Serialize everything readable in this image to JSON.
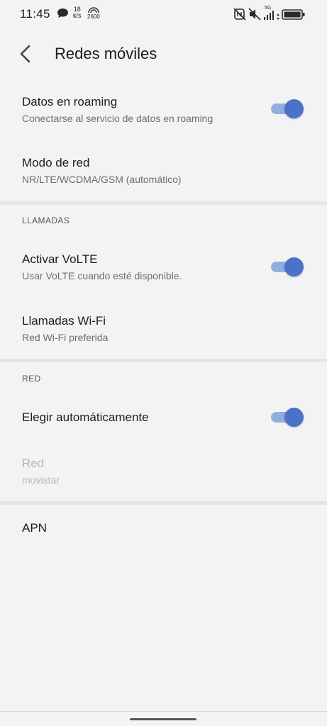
{
  "status_bar": {
    "time": "11:45",
    "speed_value": "18",
    "speed_unit": "k/s",
    "nfc_label": "2600",
    "network_type": "5G"
  },
  "header": {
    "title": "Redes móviles"
  },
  "items": {
    "roaming": {
      "title": "Datos en roaming",
      "subtitle": "Conectarse al servicio de datos en roaming",
      "enabled": true
    },
    "network_mode": {
      "title": "Modo de red",
      "subtitle": "NR/LTE/WCDMA/GSM (automático)"
    },
    "volte": {
      "title": "Activar VoLTE",
      "subtitle": "Usar VoLTE cuando esté disponible.",
      "enabled": true
    },
    "wifi_calling": {
      "title": "Llamadas Wi-Fi",
      "subtitle": "Red Wi-Fi preferida"
    },
    "auto_select": {
      "title": "Elegir automáticamente",
      "enabled": true
    },
    "network": {
      "title": "Red",
      "subtitle": "movistar",
      "disabled": true
    },
    "apn": {
      "title": "APN"
    }
  },
  "sections": {
    "calls": "LLAMADAS",
    "network": "RED"
  },
  "colors": {
    "accent": "#4a72c8",
    "accent_track": "#8fb0df",
    "background": "#f3f3f3",
    "divider": "#e4e4e4"
  }
}
